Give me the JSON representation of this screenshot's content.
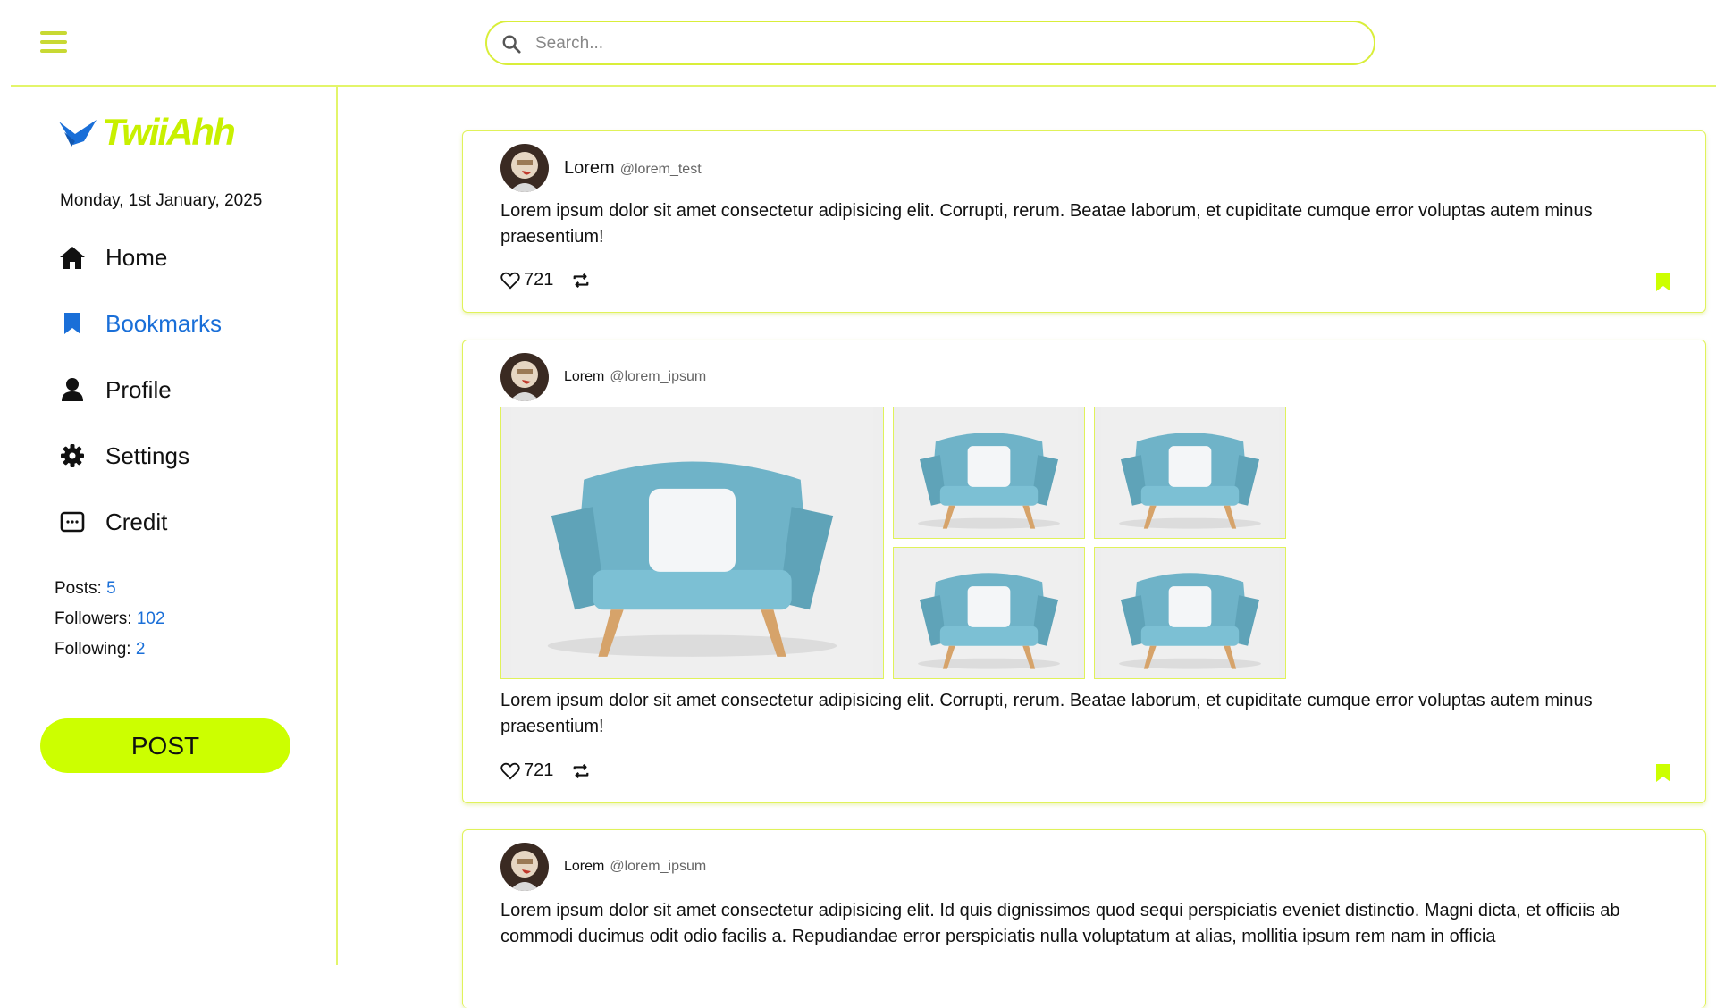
{
  "header": {
    "search_placeholder": "Search..."
  },
  "sidebar": {
    "logo_text": "TwiiAhh",
    "date": "Monday, 1st January, 2025",
    "nav": [
      {
        "label": "Home",
        "icon": "home-icon"
      },
      {
        "label": "Bookmarks",
        "icon": "bookmark-icon"
      },
      {
        "label": "Profile",
        "icon": "user-icon"
      },
      {
        "label": "Settings",
        "icon": "gear-icon"
      },
      {
        "label": "Credit",
        "icon": "credit-icon"
      }
    ],
    "stats": {
      "posts_label": "Posts:",
      "posts": "5",
      "followers_label": "Followers:",
      "followers": "102",
      "following_label": "Following:",
      "following": "2"
    },
    "post_button": "POST"
  },
  "feed": [
    {
      "name": "Lorem",
      "handle": "@lorem_test",
      "text": "Lorem ipsum dolor sit amet consectetur adipisicing elit. Corrupti, rerum. Beatae laborum, et cupiditate cumque error voluptas autem minus praesentium!",
      "likes": "721"
    },
    {
      "name": "Lorem",
      "handle": "@lorem_ipsum",
      "text": "Lorem ipsum dolor sit amet consectetur adipisicing elit. Corrupti, rerum. Beatae laborum, et cupiditate cumque error voluptas autem minus praesentium!",
      "likes": "721",
      "images": [
        "armchair-image",
        "armchair-image",
        "armchair-image",
        "armchair-image",
        "armchair-image"
      ]
    },
    {
      "name": "Lorem",
      "handle": "@lorem_ipsum",
      "text": "Lorem ipsum dolor sit amet consectetur adipisicing elit. Id quis dignissimos quod sequi perspiciatis eveniet distinctio. Magni dicta, et officiis ab commodi ducimus odit odio facilis a. Repudiandae error perspiciatis nulla voluptatum at alias, mollitia ipsum rem nam in officia"
    }
  ],
  "colors": {
    "accent": "#ccff00",
    "border": "#e0f25a",
    "link": "#1a6fd8",
    "chair": "#6fb3c8"
  }
}
